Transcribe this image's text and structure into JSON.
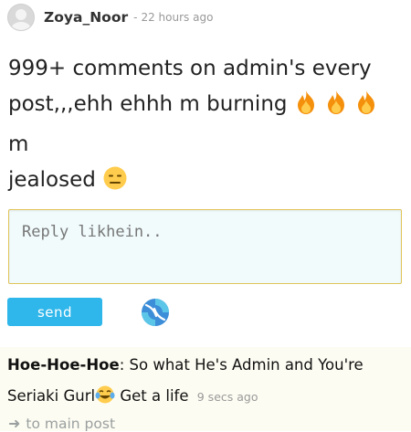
{
  "post": {
    "author": "Zoya_Noor",
    "separator": "-",
    "time": "22 hours ago",
    "text_line1": "999+ comments on admin's every",
    "text_line2_before": "post,,,ehh ehhh m burning",
    "text_line2_after": "m",
    "text_line3": "jealosed",
    "emojis": [
      "fire",
      "fire",
      "fire",
      "expressionless-face"
    ]
  },
  "reply_form": {
    "placeholder": "Reply likhein..",
    "send_label": "send"
  },
  "reply": {
    "author": "Hoe-Hoe-Hoe",
    "text_part1": ": So what He's Admin and You're",
    "text_part2": "Seriaki Gurl",
    "text_part3": " Get a life",
    "time": "9 secs ago",
    "emoji": "tears-of-joy"
  },
  "navigation": {
    "to_main_label": "to main post"
  },
  "colors": {
    "send_button": "#2fb6ea",
    "reply_box_bg": "#f1fbfc",
    "reply_box_border": "#e0c45a",
    "reply_area_bg": "#fdfcf2",
    "muted_text": "#999999"
  }
}
